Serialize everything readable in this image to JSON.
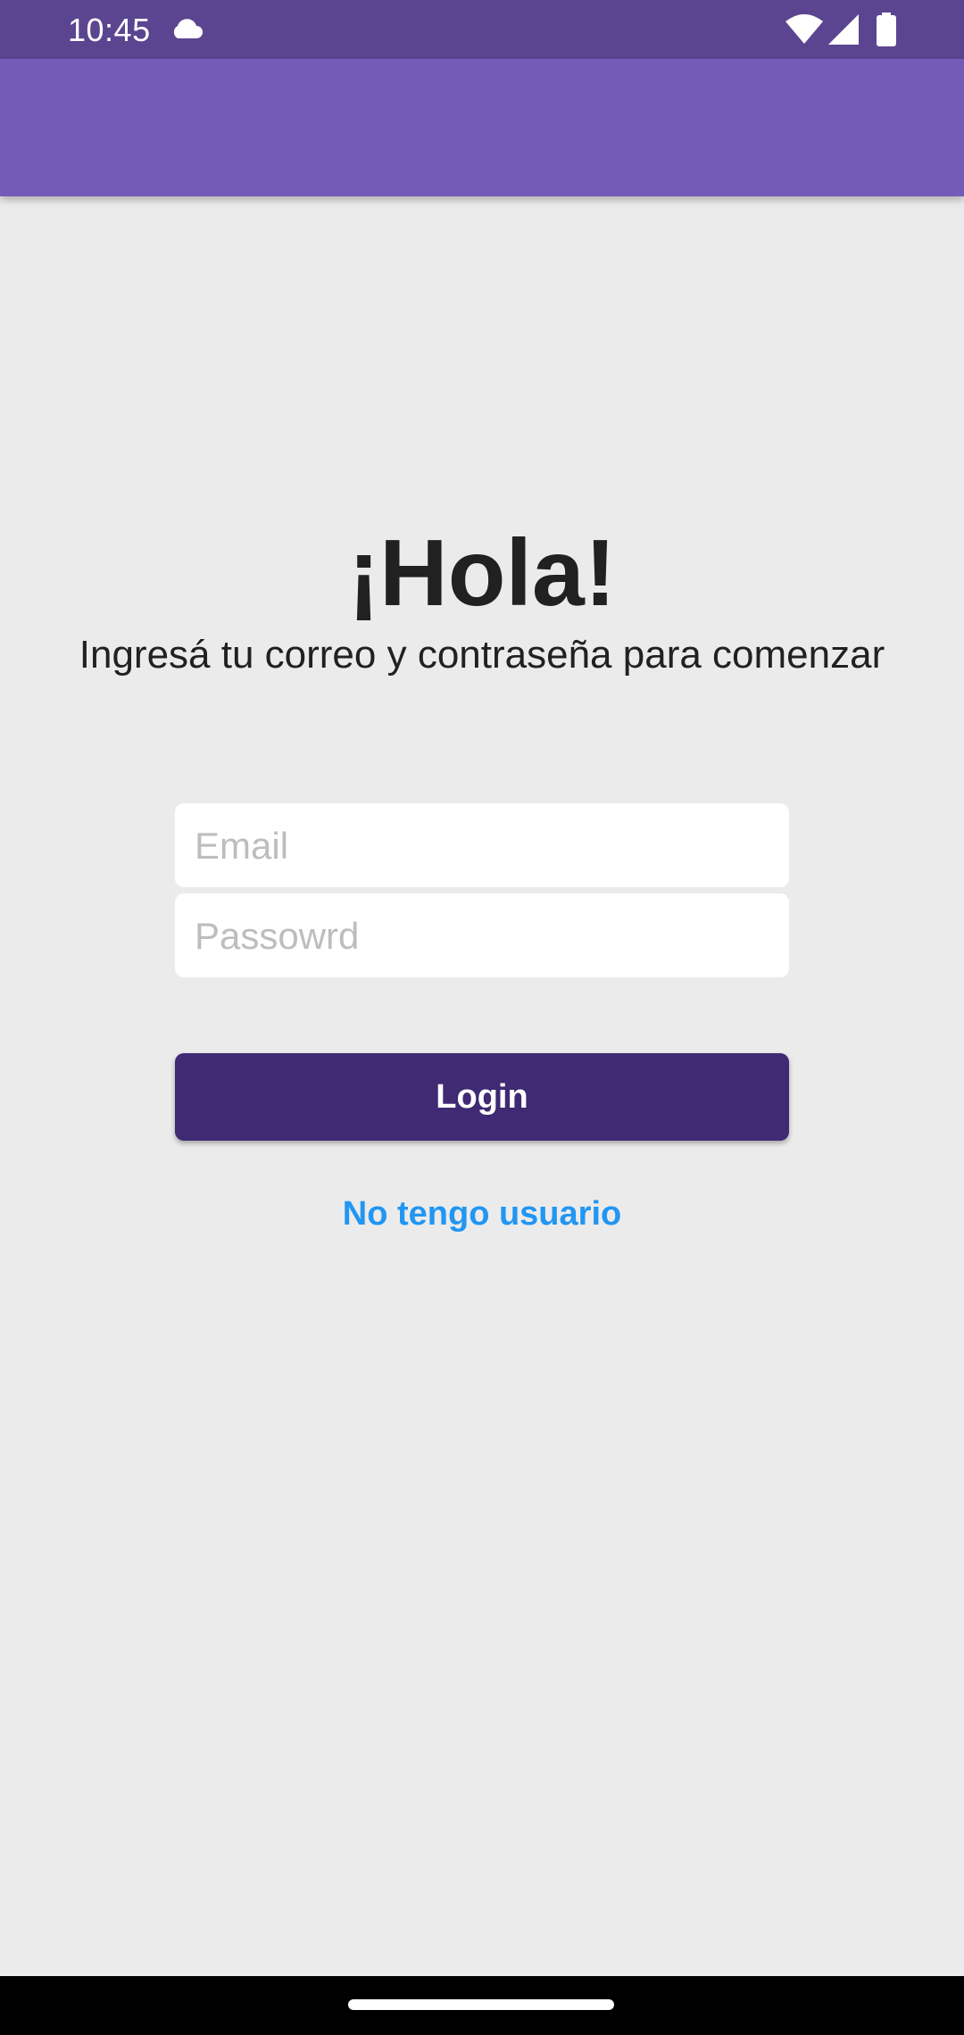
{
  "status_bar": {
    "time": "10:45",
    "icons": [
      "cloud-icon",
      "wifi-icon",
      "signal-icon",
      "battery-icon"
    ]
  },
  "colors": {
    "status_bar": "#5b4590",
    "app_bar": "#755bb8",
    "primary_dark": "#3f2a73",
    "link": "#2196f3",
    "background": "#ebebeb"
  },
  "main": {
    "title": "¡Hola!",
    "subtitle": "Ingresá tu correo y contraseña para comenzar",
    "email": {
      "placeholder": "Email",
      "value": ""
    },
    "password": {
      "placeholder": "Passowrd",
      "value": ""
    },
    "login_label": "Login",
    "register_label": "No tengo usuario"
  }
}
